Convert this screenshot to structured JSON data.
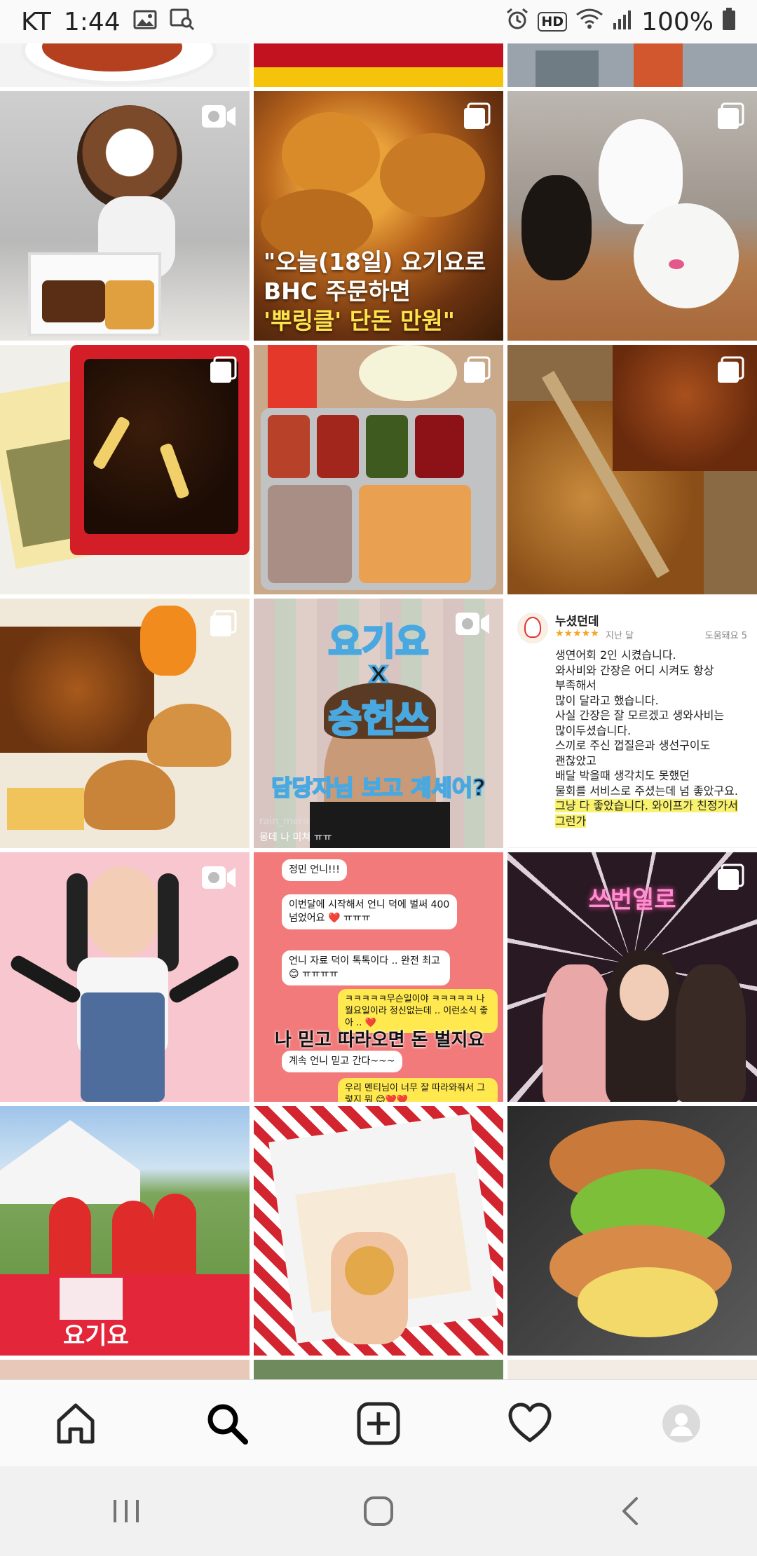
{
  "status_bar": {
    "carrier": "KT",
    "time": "1:44",
    "hd_label": "HD",
    "battery": "100%"
  },
  "tiles": {
    "t_bhc_text_line1": "\"오늘(18일) 요기요로",
    "t_bhc_text_line2": "BHC 주문하면",
    "t_bhc_text_line3": "'뿌링클' 단돈 만원\"",
    "t_video_title1": "요기요",
    "t_video_title2": "x",
    "t_video_title3": "승헌쓰",
    "t_video_subtitle": "담당자님 보고 계세어?",
    "t_video_user": "rain_mera",
    "t_video_comment": "몽데 나 미쳐 ㅠㅠ",
    "t_chat_banner": "나 믿고 따라오면 돈 벌지요",
    "t_chat_msgs": [
      "정민 언니!!!",
      "이번달에 시작해서 언니 덕에 벌써 400 넘었어요 ❤️ ㅠㅠㅠ",
      "언니 자료 덕이 톡톡이다 .. 완전 최고 😊 ㅠㅠㅠㅠ",
      "ㅋㅋㅋㅋㅋ무슨일이야 ㅋㅋㅋㅋㅋ 나 월요일이라 정신없는데 .. 이런소식 좋아 .. ❤️",
      "계속 언니 믿고 간다~~~",
      "우리 멘티님이 너무 잘 따라와줘서 그렇지 뭐 😊❤️❤️"
    ],
    "t_neon_sign": "쓰번일로",
    "t_booth_sign": "요기요"
  },
  "review": {
    "name": "누셨던데",
    "stars": "★★★★★",
    "date": "지난 달",
    "helpful": "도움돼요 5",
    "lines": [
      "생연어회 2인 시켰습니다.",
      "와사비와 간장은 어디 시켜도 항상",
      "부족해서",
      "많이 달라고 했습니다.",
      "사실 간장은 잘 모르겠고 생와사비는",
      "많이두셨습니다.",
      "스끼로 주신 껍질은과 생선구이도",
      "괜찮았고",
      "배달 박을때 생각치도 못했던",
      "물회를 서비스로 주셨는데 넘 좋았구요."
    ],
    "highlight_lines": [
      "그냥 다 좋았습니다. 와이프가 친정가서",
      "그런가"
    ]
  },
  "colors": {
    "status_bg": "#fafafa",
    "nav_bg": "#fafafa",
    "sys_nav_bg": "#f1f1f1",
    "icon": "#262626",
    "sys_icon": "#737373"
  },
  "icons": {
    "nav": [
      "home-icon",
      "search-icon",
      "add-post-icon",
      "heart-icon",
      "profile-avatar-icon"
    ],
    "system": [
      "recents-icon",
      "home-button-icon",
      "back-icon"
    ]
  }
}
